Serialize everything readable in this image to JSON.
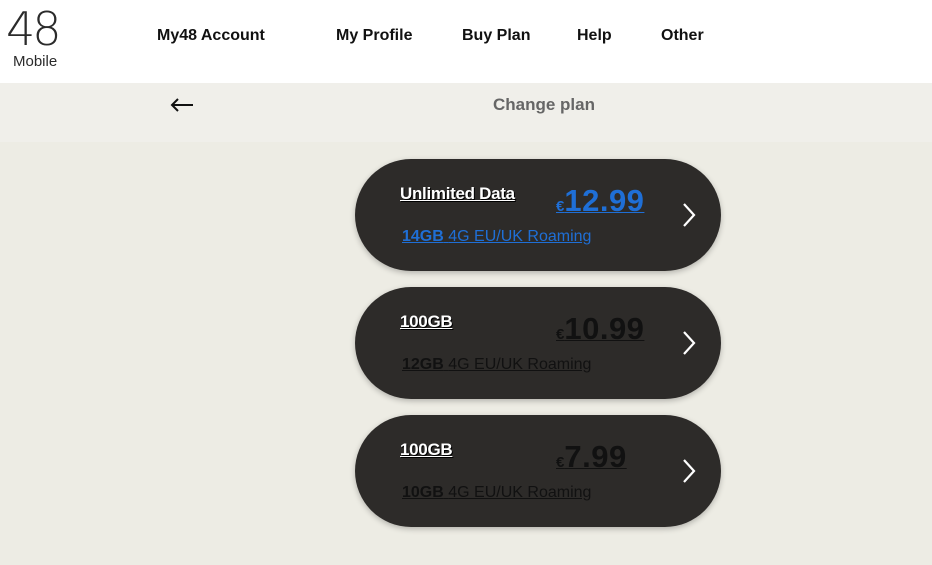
{
  "brand": {
    "logo_number": "48",
    "logo_word": "Mobile"
  },
  "nav": {
    "items": [
      {
        "label": "My48 Account"
      },
      {
        "label": "My Profile"
      },
      {
        "label": "Buy Plan"
      },
      {
        "label": "Help"
      },
      {
        "label": "Other"
      }
    ]
  },
  "header": {
    "title": "Change plan",
    "back_icon": "arrow-left-icon"
  },
  "plans": [
    {
      "name": "Unlimited Data",
      "currency": "€",
      "price": "12.99",
      "allowance_gb": "14GB",
      "allowance_text": "4G EU/UK Roaming",
      "accent": "#1f6fd6"
    },
    {
      "name": "100GB",
      "currency": "€",
      "price": "10.99",
      "allowance_gb": "12GB",
      "allowance_text": "4G EU/UK Roaming"
    },
    {
      "name": "100GB",
      "currency": "€",
      "price": "7.99",
      "allowance_gb": "10GB",
      "allowance_text": "4G EU/UK Roaming"
    }
  ],
  "colors": {
    "card_bg": "#2d2b29",
    "page_bg": "#edece4",
    "subbar_bg": "#f0efea",
    "link_blue": "#1f6fd6"
  }
}
